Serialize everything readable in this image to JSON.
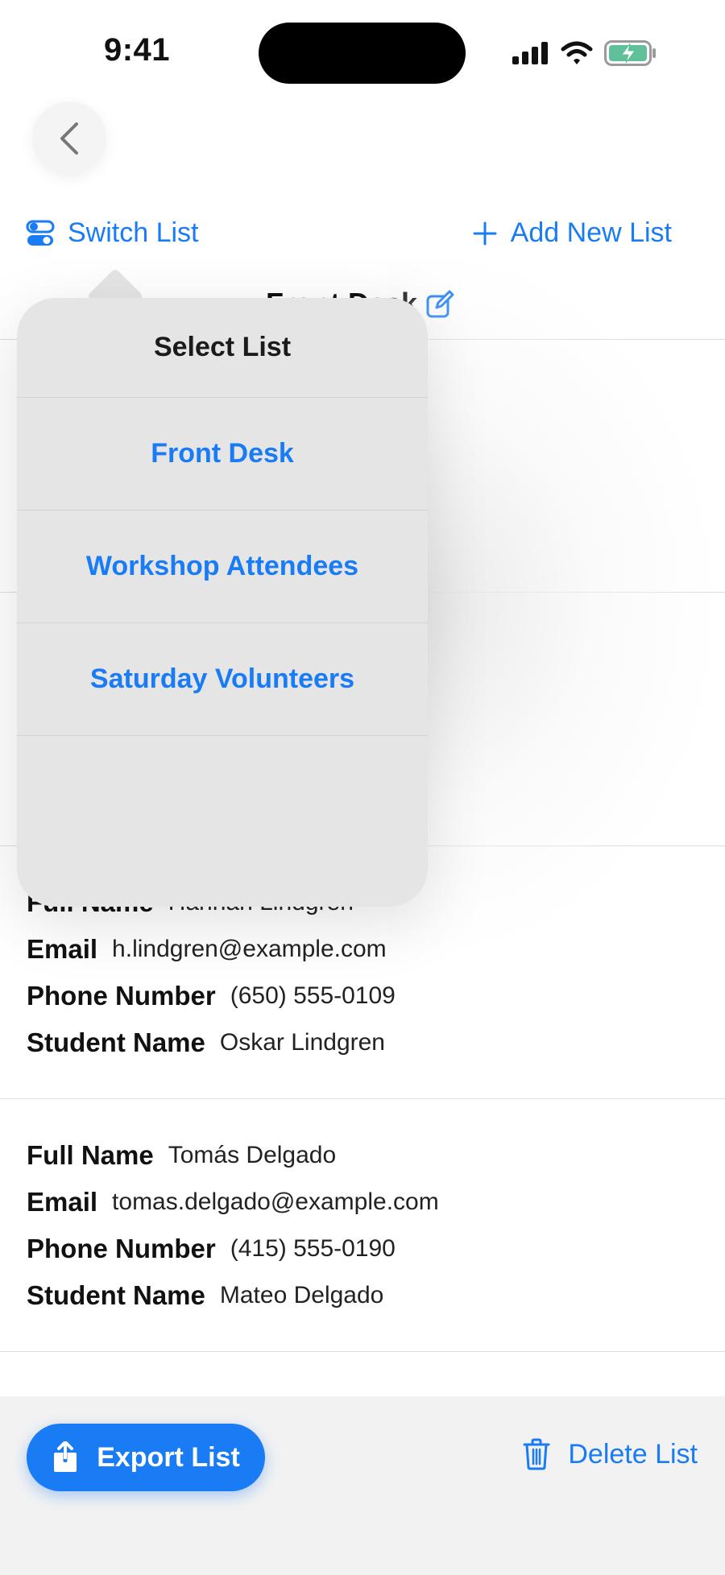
{
  "status_bar": {
    "time": "9:41"
  },
  "toolbar": {
    "switch_list_label": "Switch List",
    "add_list_label": "Add New List"
  },
  "list": {
    "title": "Front Desk"
  },
  "popover": {
    "title": "Select List",
    "items": [
      "Front Desk",
      "Workshop Attendees",
      "Saturday Volunteers"
    ]
  },
  "field_labels": {
    "full_name": "Full Name",
    "email": "Email",
    "phone": "Phone Number",
    "student": "Student Name"
  },
  "entries": [
    {
      "full_name": "Hannah Lindgren",
      "email": "h.lindgren@example.com",
      "phone": "(650) 555-0109",
      "student": "Oskar Lindgren"
    },
    {
      "full_name": "Tomás Delgado",
      "email": "tomas.delgado@example.com",
      "phone": "(415) 555-0190",
      "student": "Mateo Delgado"
    }
  ],
  "bottom_bar": {
    "export_label": "Export List",
    "delete_label": "Delete List"
  },
  "colors": {
    "accent": "#1a7cf5",
    "battery": "#5fc09a"
  }
}
